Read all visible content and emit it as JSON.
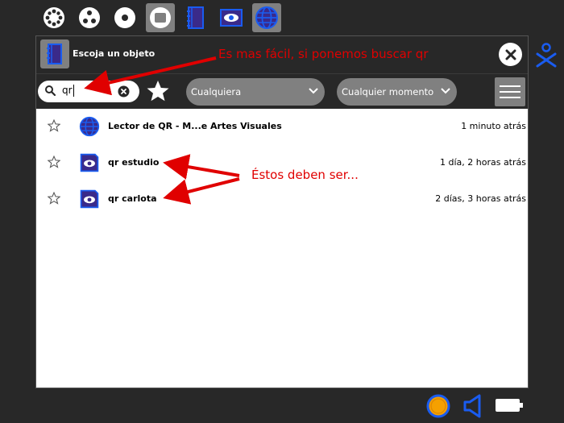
{
  "toolbar": {
    "items": [
      {
        "name": "neighborhood-view-icon"
      },
      {
        "name": "group-view-icon"
      },
      {
        "name": "home-view-icon"
      },
      {
        "name": "activity-view-icon",
        "active": true
      },
      {
        "name": "journal-icon"
      },
      {
        "name": "image-viewer-icon"
      },
      {
        "name": "browse-icon",
        "active": true
      }
    ]
  },
  "dialog": {
    "title": "Escoja un objeto",
    "search": {
      "value": "qr"
    },
    "filters": {
      "type_label": "Cualquiera",
      "date_label": "Cualquier momento"
    },
    "entries": [
      {
        "title": "Lector de QR - M...e Artes Visuales",
        "time": "1 minuto atrás",
        "icon": "browse-icon",
        "starred": false
      },
      {
        "title": "qr estudio",
        "time": "1 día, 2 horas atrás",
        "icon": "image-viewer-icon",
        "starred": false
      },
      {
        "title": "qr carlota",
        "time": "2 días, 3 horas atrás",
        "icon": "image-viewer-icon",
        "starred": false
      }
    ]
  },
  "annotations": {
    "search_hint": "Es mas fácil, si ponemos buscar qr",
    "results_hint": "Éstos deben ser..."
  },
  "tray": {
    "items": [
      {
        "name": "network-icon"
      },
      {
        "name": "speaker-icon"
      },
      {
        "name": "battery-icon"
      }
    ]
  },
  "colors": {
    "frame": "#282828",
    "button_gray": "#808080",
    "accent_blue": "#1a5cf0",
    "annotation_red": "#e00000",
    "tray_orange": "#f5a000"
  }
}
